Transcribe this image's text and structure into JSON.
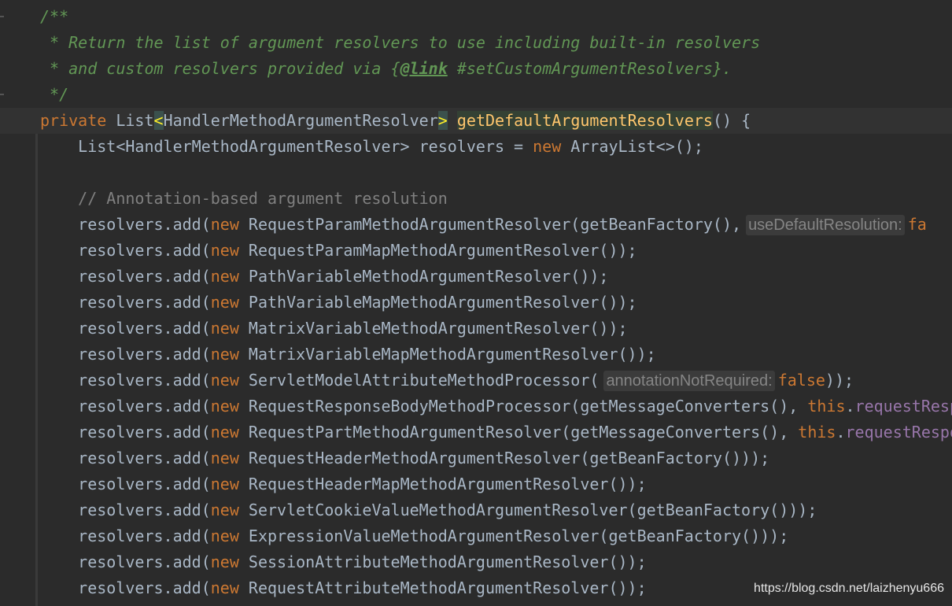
{
  "code": {
    "javadoc": {
      "open": "/**",
      "line1": " * Return the list of argument resolvers to use including built-in resolvers",
      "line2_pre": " * and custom resolvers provided via {",
      "line2_tag": "@link",
      "line2_post": " #setCustomArgumentResolvers}.",
      "close": " */"
    },
    "signature": {
      "kw_private": "private",
      "type_list": " List",
      "lt": "<",
      "type_param": "HandlerMethodArgumentResolver",
      "gt": ">",
      "method_name": "getDefaultArgumentResolvers",
      "tail": "() {"
    },
    "decl": {
      "left": "    List<HandlerMethodArgumentResolver> resolvers = ",
      "kw_new": "new",
      "right": " ArrayList<>();"
    },
    "comment": "    // Annotation-based argument resolution",
    "add_prefix": "    resolvers.add(",
    "kw_new": "new",
    "kw_this": "this",
    "add_lines": [
      {
        "cls": " RequestParamMethodArgumentResolver(getBeanFactory(),",
        "hint": "useDefaultResolution:",
        "tail": "fa"
      },
      {
        "cls": " RequestParamMapMethodArgumentResolver());"
      },
      {
        "cls": " PathVariableMethodArgumentResolver());"
      },
      {
        "cls": " PathVariableMapMethodArgumentResolver());"
      },
      {
        "cls": " MatrixVariableMethodArgumentResolver());"
      },
      {
        "cls": " MatrixVariableMapMethodArgumentResolver());"
      },
      {
        "cls": " ServletModelAttributeMethodProcessor(",
        "hint": "annotationNotRequired:",
        "tail": "false",
        "end": "));"
      },
      {
        "cls": " RequestResponseBodyMethodProcessor(getMessageConverters(), ",
        "this_field": "requestResp"
      },
      {
        "cls": " RequestPartMethodArgumentResolver(getMessageConverters(), ",
        "this_field": "requestRespo"
      },
      {
        "cls": " RequestHeaderMethodArgumentResolver(getBeanFactory()));"
      },
      {
        "cls": " RequestHeaderMapMethodArgumentResolver());"
      },
      {
        "cls": " ServletCookieValueMethodArgumentResolver(getBeanFactory()));"
      },
      {
        "cls": " ExpressionValueMethodArgumentResolver(getBeanFactory()));"
      },
      {
        "cls": " SessionAttributeMethodArgumentResolver());"
      },
      {
        "cls": " RequestAttributeMethodArgumentResolver());"
      }
    ]
  },
  "watermark": "https://blog.csdn.net/laizhenyu666",
  "colors": {
    "background": "#2b2b2b",
    "keyword": "#cc7832",
    "method": "#ffc66d",
    "javadoc": "#629755",
    "comment": "#808080",
    "field": "#9876aa",
    "text": "#a9b7c6"
  },
  "icons": {
    "gutter": "lightbulb-icon"
  }
}
